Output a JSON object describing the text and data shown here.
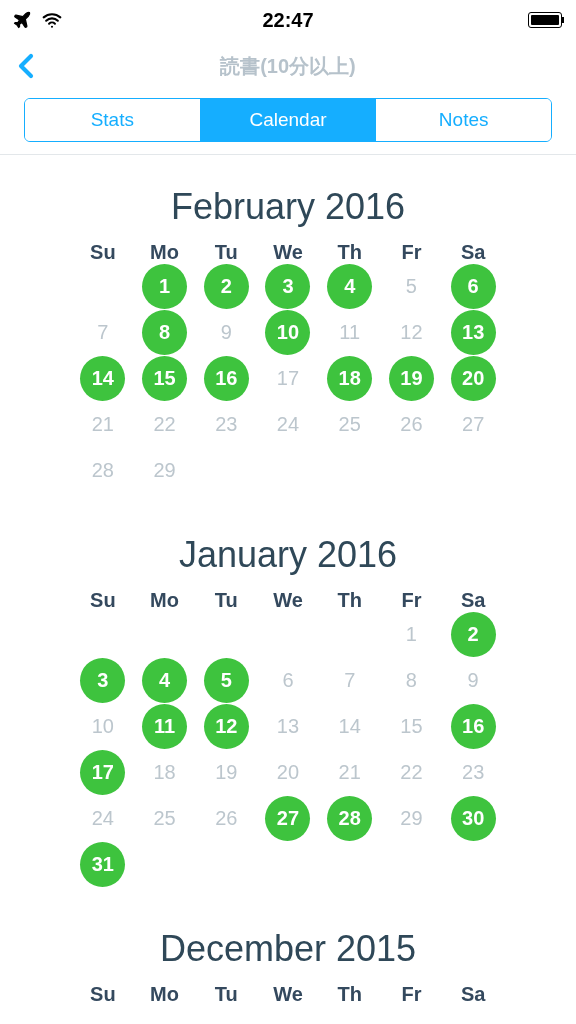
{
  "status_bar": {
    "time": "22:47"
  },
  "nav": {
    "title": "読書(10分以上)"
  },
  "tabs": [
    {
      "label": "Stats",
      "selected": false
    },
    {
      "label": "Calendar",
      "selected": true
    },
    {
      "label": "Notes",
      "selected": false
    }
  ],
  "months": [
    {
      "title": "February 2016",
      "weekdays": [
        "Su",
        "Mo",
        "Tu",
        "We",
        "Th",
        "Fr",
        "Sa"
      ],
      "weeks": [
        [
          {
            "kind": "blank"
          },
          {
            "kind": "day",
            "day": "1",
            "done": true
          },
          {
            "kind": "day",
            "day": "2",
            "done": true
          },
          {
            "kind": "day",
            "day": "3",
            "done": true
          },
          {
            "kind": "day",
            "day": "4",
            "done": true
          },
          {
            "kind": "day",
            "day": "5",
            "done": false
          },
          {
            "kind": "day",
            "day": "6",
            "done": true
          }
        ],
        [
          {
            "kind": "day",
            "day": "7",
            "done": false
          },
          {
            "kind": "day",
            "day": "8",
            "done": true
          },
          {
            "kind": "day",
            "day": "9",
            "done": false
          },
          {
            "kind": "day",
            "day": "10",
            "done": true
          },
          {
            "kind": "day",
            "day": "11",
            "done": false
          },
          {
            "kind": "day",
            "day": "12",
            "done": false
          },
          {
            "kind": "day",
            "day": "13",
            "done": true
          }
        ],
        [
          {
            "kind": "day",
            "day": "14",
            "done": true
          },
          {
            "kind": "day",
            "day": "15",
            "done": true
          },
          {
            "kind": "day",
            "day": "16",
            "done": true
          },
          {
            "kind": "day",
            "day": "17",
            "done": false
          },
          {
            "kind": "day",
            "day": "18",
            "done": true
          },
          {
            "kind": "day",
            "day": "19",
            "done": true
          },
          {
            "kind": "day",
            "day": "20",
            "done": true
          }
        ],
        [
          {
            "kind": "day",
            "day": "21",
            "done": false
          },
          {
            "kind": "day",
            "day": "22",
            "done": false
          },
          {
            "kind": "day",
            "day": "23",
            "done": false
          },
          {
            "kind": "day",
            "day": "24",
            "done": false
          },
          {
            "kind": "day",
            "day": "25",
            "done": false
          },
          {
            "kind": "day",
            "day": "26",
            "done": false
          },
          {
            "kind": "day",
            "day": "27",
            "done": false
          }
        ],
        [
          {
            "kind": "day",
            "day": "28",
            "done": false
          },
          {
            "kind": "day",
            "day": "29",
            "done": false
          }
        ]
      ]
    },
    {
      "title": "January 2016",
      "weekdays": [
        "Su",
        "Mo",
        "Tu",
        "We",
        "Th",
        "Fr",
        "Sa"
      ],
      "weeks": [
        [
          {
            "kind": "blank"
          },
          {
            "kind": "blank"
          },
          {
            "kind": "blank"
          },
          {
            "kind": "blank"
          },
          {
            "kind": "blank"
          },
          {
            "kind": "day",
            "day": "1",
            "done": false
          },
          {
            "kind": "day",
            "day": "2",
            "done": true
          }
        ],
        [
          {
            "kind": "day",
            "day": "3",
            "done": true
          },
          {
            "kind": "day",
            "day": "4",
            "done": true
          },
          {
            "kind": "day",
            "day": "5",
            "done": true
          },
          {
            "kind": "day",
            "day": "6",
            "done": false
          },
          {
            "kind": "day",
            "day": "7",
            "done": false
          },
          {
            "kind": "day",
            "day": "8",
            "done": false
          },
          {
            "kind": "day",
            "day": "9",
            "done": false
          }
        ],
        [
          {
            "kind": "day",
            "day": "10",
            "done": false
          },
          {
            "kind": "day",
            "day": "11",
            "done": true
          },
          {
            "kind": "day",
            "day": "12",
            "done": true
          },
          {
            "kind": "day",
            "day": "13",
            "done": false
          },
          {
            "kind": "day",
            "day": "14",
            "done": false
          },
          {
            "kind": "day",
            "day": "15",
            "done": false
          },
          {
            "kind": "day",
            "day": "16",
            "done": true
          }
        ],
        [
          {
            "kind": "day",
            "day": "17",
            "done": true
          },
          {
            "kind": "day",
            "day": "18",
            "done": false
          },
          {
            "kind": "day",
            "day": "19",
            "done": false
          },
          {
            "kind": "day",
            "day": "20",
            "done": false
          },
          {
            "kind": "day",
            "day": "21",
            "done": false
          },
          {
            "kind": "day",
            "day": "22",
            "done": false
          },
          {
            "kind": "day",
            "day": "23",
            "done": false
          }
        ],
        [
          {
            "kind": "day",
            "day": "24",
            "done": false
          },
          {
            "kind": "day",
            "day": "25",
            "done": false
          },
          {
            "kind": "day",
            "day": "26",
            "done": false
          },
          {
            "kind": "day",
            "day": "27",
            "done": true
          },
          {
            "kind": "day",
            "day": "28",
            "done": true
          },
          {
            "kind": "day",
            "day": "29",
            "done": false
          },
          {
            "kind": "day",
            "day": "30",
            "done": true
          }
        ],
        [
          {
            "kind": "day",
            "day": "31",
            "done": true
          }
        ]
      ]
    },
    {
      "title": "December 2015",
      "weekdays": [
        "Su",
        "Mo",
        "Tu",
        "We",
        "Th",
        "Fr",
        "Sa"
      ]
    }
  ]
}
